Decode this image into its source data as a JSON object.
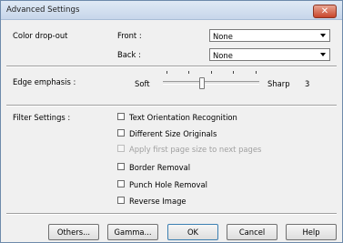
{
  "window": {
    "title": "Advanced Settings",
    "close_label": "✕"
  },
  "color_dropout": {
    "label": "Color drop-out",
    "front_label": "Front :",
    "front_value": "None",
    "back_label": "Back :",
    "back_value": "None"
  },
  "edge_emphasis": {
    "label": "Edge emphasis :",
    "min_label": "Soft",
    "max_label": "Sharp",
    "value": "3",
    "level": 0.4
  },
  "filter_settings": {
    "label": "Filter Settings :",
    "options": [
      {
        "label": "Text Orientation Recognition",
        "checked": false,
        "enabled": true
      },
      {
        "label": "Different Size Originals",
        "checked": false,
        "enabled": true
      },
      {
        "label": "Apply first page size to next pages",
        "checked": false,
        "enabled": false
      },
      {
        "label": "Border Removal",
        "checked": false,
        "enabled": true
      },
      {
        "label": "Punch Hole Removal",
        "checked": false,
        "enabled": true
      },
      {
        "label": "Reverse Image",
        "checked": false,
        "enabled": true
      }
    ]
  },
  "buttons": {
    "others": "Others...",
    "gamma": "Gamma...",
    "ok": "OK",
    "cancel": "Cancel",
    "help": "Help"
  }
}
